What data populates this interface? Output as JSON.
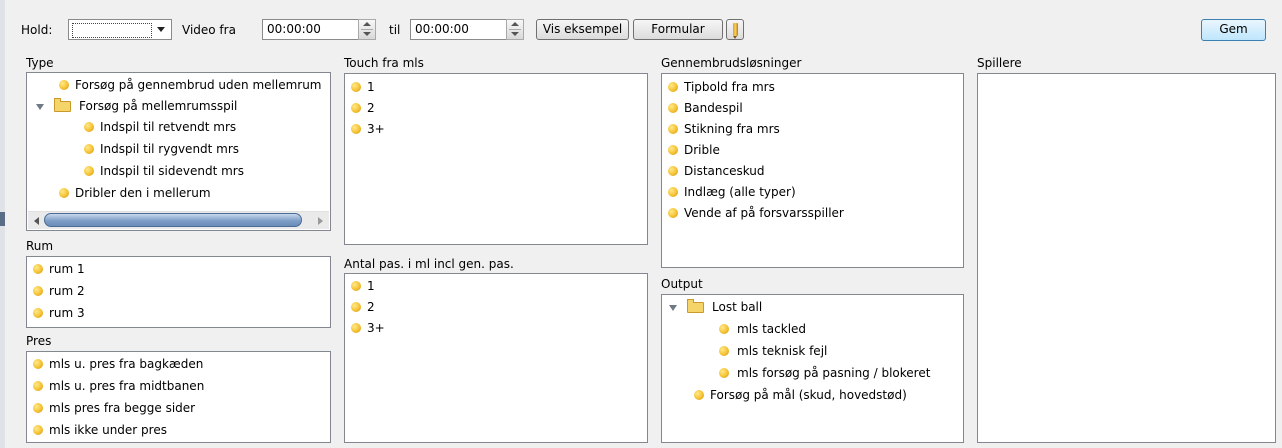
{
  "toolbar": {
    "hold_label": "Hold:",
    "hold_value": "",
    "video_fra_label": "Video fra",
    "video_fra_value": "00:00:00",
    "til_label": "til",
    "til_value": "00:00:00",
    "vis_eksempel_label": "Vis eksempel",
    "formular_label": "Formular",
    "gem_label": "Gem"
  },
  "type": {
    "title": "Type",
    "items": [
      {
        "label": "Forsøg på gennembrud uden mellemrum",
        "kind": "leaf"
      },
      {
        "label": "Forsøg på mellemrumsspil",
        "kind": "folder",
        "expanded": true
      },
      {
        "label": "Indspil til retvendt mrs",
        "kind": "leaf"
      },
      {
        "label": "Indspil til rygvendt mrs",
        "kind": "leaf"
      },
      {
        "label": "Indspil til sidevendt mrs",
        "kind": "leaf"
      },
      {
        "label": "Dribler den i mellerum",
        "kind": "leaf"
      }
    ]
  },
  "rum": {
    "title": "Rum",
    "items": [
      "rum 1",
      "rum 2",
      "rum 3"
    ]
  },
  "pres": {
    "title": "Pres",
    "items": [
      "mls u. pres fra bagkæden",
      "mls u. pres fra midtbanen",
      "mls pres fra begge sider",
      "mls ikke under pres"
    ]
  },
  "touch": {
    "title": "Touch fra mls",
    "items": [
      "1",
      "2",
      "3+"
    ]
  },
  "antal": {
    "title": "Antal pas. i ml incl gen. pas.",
    "items": [
      "1",
      "2",
      "3+"
    ]
  },
  "gennembrud": {
    "title": "Gennembrudsløsninger",
    "items": [
      "Tipbold fra mrs",
      "Bandespil",
      "Stikning fra mrs",
      "Drible",
      "Distanceskud",
      "Indlæg (alle typer)",
      "Vende af på forsvarsspiller"
    ]
  },
  "output": {
    "title": "Output",
    "items": [
      {
        "label": "Lost ball",
        "kind": "folder",
        "expanded": true
      },
      {
        "label": "mls tackled",
        "kind": "leaf"
      },
      {
        "label": "mls teknisk fejl",
        "kind": "leaf"
      },
      {
        "label": "mls forsøg på pasning / blokeret",
        "kind": "leaf"
      },
      {
        "label": "Forsøg på mål (skud, hovedstød)",
        "kind": "leaf"
      }
    ]
  },
  "spillere": {
    "title": "Spillere",
    "items": []
  },
  "colors": {
    "bullet": "#f5c232",
    "folder": "#f5d56a",
    "scroll_thumb": "#7e9ec7",
    "gem_button": "#bee6fd"
  }
}
